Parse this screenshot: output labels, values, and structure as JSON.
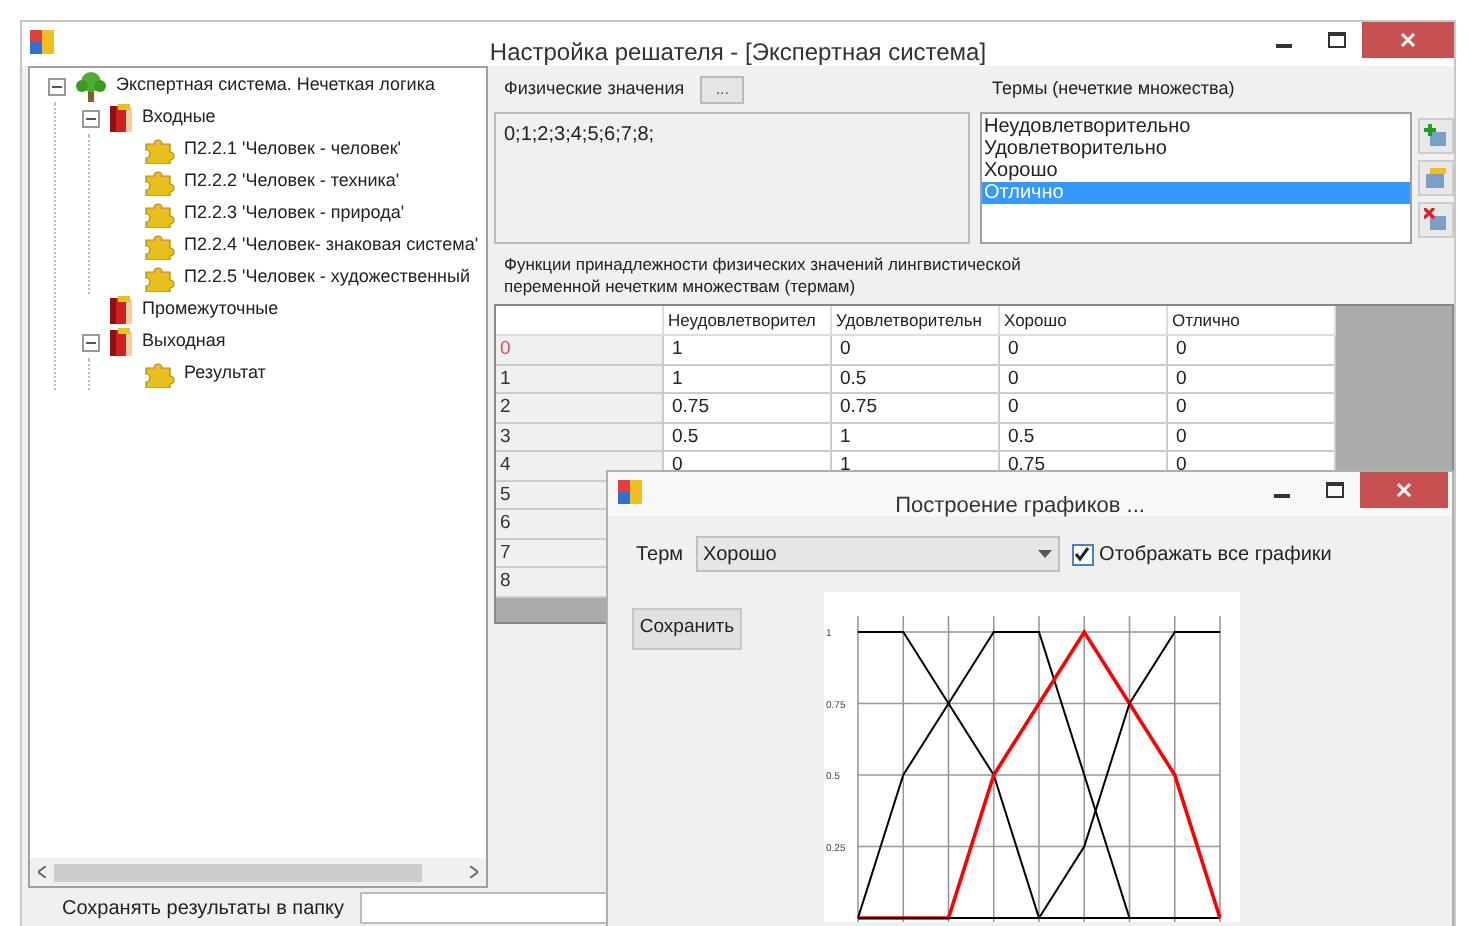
{
  "window": {
    "title": "Настройка решателя - [Экспертная система]"
  },
  "tree": [
    {
      "label": "Экспертная система. Нечеткая логика",
      "kind": "root",
      "expanded": true,
      "children": [
        {
          "label": "Входные",
          "kind": "folder",
          "expanded": true,
          "children": [
            {
              "label": "П2.2.1 'Человек - человек'",
              "kind": "leaf"
            },
            {
              "label": "П2.2.2 'Человек - техника'",
              "kind": "leaf"
            },
            {
              "label": "П2.2.3 'Человек - природа'",
              "kind": "leaf"
            },
            {
              "label": "П2.2.4 'Человек- знаковая система'",
              "kind": "leaf"
            },
            {
              "label": "П2.2.5 'Человек - художественный",
              "kind": "leaf"
            }
          ]
        },
        {
          "label": "Промежуточные",
          "kind": "folder"
        },
        {
          "label": "Выходная",
          "kind": "folder",
          "expanded": true,
          "children": [
            {
              "label": "Результат",
              "kind": "leaf"
            }
          ]
        }
      ]
    }
  ],
  "physical": {
    "label": "Физические значения",
    "button": "...",
    "value": "0;1;2;3;4;5;6;7;8;"
  },
  "terms": {
    "label": "Термы (нечеткие множества)",
    "items": [
      {
        "label": "Неудовлетворительно",
        "selected": false
      },
      {
        "label": "Удовлетворительно",
        "selected": false
      },
      {
        "label": "Хорошо",
        "selected": false
      },
      {
        "label": "Отлично",
        "selected": true
      }
    ]
  },
  "table": {
    "caption": "Функции принадлежности физических значений лингвистической переменной нечетким множествам (термам)",
    "columns": [
      "Неудовлетворител",
      "Удовлетворительн",
      "Хорошо",
      "Отлично"
    ],
    "rows": [
      {
        "header": "0",
        "current": true,
        "cells": [
          "1",
          "0",
          "0",
          "0"
        ]
      },
      {
        "header": "1",
        "current": false,
        "cells": [
          "1",
          "0.5",
          "0",
          "0"
        ]
      },
      {
        "header": "2",
        "current": false,
        "cells": [
          "0.75",
          "0.75",
          "0",
          "0"
        ]
      },
      {
        "header": "3",
        "current": false,
        "cells": [
          "0.5",
          "1",
          "0.5",
          "0"
        ]
      },
      {
        "header": "4",
        "current": false,
        "cells": [
          "0",
          "1",
          "0.75",
          "0"
        ]
      },
      {
        "header": "5",
        "current": false
      },
      {
        "header": "6",
        "current": false
      },
      {
        "header": "7",
        "current": false
      },
      {
        "header": "8",
        "current": false
      }
    ]
  },
  "save_folder": {
    "label": "Сохранять результаты в папку"
  },
  "dialog": {
    "title": "Построение графиков ...",
    "term_label": "Терм",
    "term_value": "Хорошо",
    "show_all": {
      "label": "Отображать все графики",
      "checked": true
    },
    "save_button": "Сохранить",
    "chart_data": {
      "type": "line",
      "grid": true,
      "ylim": [
        0,
        1
      ],
      "yticks": [
        0.25,
        0.5,
        0.75,
        1
      ],
      "series": [
        {
          "color": "#000000",
          "values": [
            1,
            1,
            0.75,
            0.5,
            0,
            0,
            0,
            0,
            0
          ]
        },
        {
          "color": "#000000",
          "values": [
            0,
            0.5,
            0.75,
            1,
            1,
            0.5,
            0,
            0,
            0
          ]
        },
        {
          "color": "#ff0000",
          "values": [
            0,
            0,
            0,
            0.5,
            0.75,
            1,
            0.75,
            0.5,
            0
          ]
        },
        {
          "color": "#000000",
          "values": [
            0,
            0,
            0,
            0,
            0,
            0.25,
            0.75,
            1,
            1
          ]
        }
      ]
    }
  }
}
